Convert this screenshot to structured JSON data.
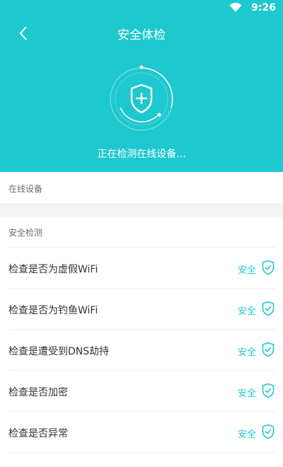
{
  "status_bar": {
    "time": "9:26"
  },
  "header": {
    "title": "安全体检",
    "scan_status": "正在检测在线设备..."
  },
  "sections": {
    "online_devices": "在线设备",
    "security_check": "安全检测"
  },
  "checks": [
    {
      "label": "检查是否为虚假WiFi",
      "result": "安全"
    },
    {
      "label": "检查是否为钓鱼WiFi",
      "result": "安全"
    },
    {
      "label": "检查是遭受到DNS劫持",
      "result": "安全"
    },
    {
      "label": "检查是否加密",
      "result": "安全"
    },
    {
      "label": "检查是否异常",
      "result": "安全"
    }
  ],
  "colors": {
    "accent": "#1ec8cf",
    "header_bg": "#1ec8cf"
  }
}
